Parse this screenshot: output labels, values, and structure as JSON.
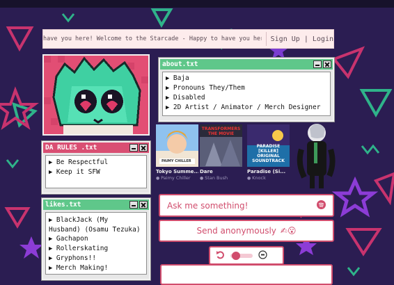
{
  "marquee": {
    "text": "have you here!     Welcome to the Starcade - Happy to have you here!"
  },
  "auth": {
    "signup": "Sign Up",
    "separator": "|",
    "login": "Login"
  },
  "about": {
    "title": "about.txt",
    "items": [
      "Baja",
      "Pronouns They/Them",
      "Disabled",
      "2D Artist / Animator / Merch Designer"
    ]
  },
  "rules": {
    "title": "DA RULES .txt",
    "items": [
      "Be Respectful",
      "Keep it SFW"
    ]
  },
  "likes": {
    "title": "likes.txt",
    "items": [
      "BlackJack (My Husband) (Osamu Tezuka)",
      "Gachapon",
      "Rollerskating",
      "Gryphons!!",
      "Merch Making!"
    ]
  },
  "albums": [
    {
      "title": "Tokyo Summe...",
      "artist": "Paimy Chiller",
      "cover_label": "PAIMY CHILLER"
    },
    {
      "title": "Dare",
      "artist": "Stan Bush",
      "cover_label": "TRANSFORMERS THE MOVIE"
    },
    {
      "title": "Paradise (Si...",
      "artist": "Knock",
      "cover_label": "PARADISE [KILLER] ORIGINAL SOUNDTRACK"
    }
  ],
  "ask": {
    "placeholder": "Ask me something!",
    "send_label": "Send anonymously",
    "send_emoji": "✍😮"
  },
  "colors": {
    "about_titlebar": "#5fc78a",
    "rules_titlebar": "#d94f73",
    "likes_titlebar": "#5fc78a",
    "accent": "#d14d6d",
    "background": "#2b1d52"
  },
  "icons": {
    "ask": "spotify-icon",
    "undo": "undo-icon",
    "record": "record-icon"
  }
}
